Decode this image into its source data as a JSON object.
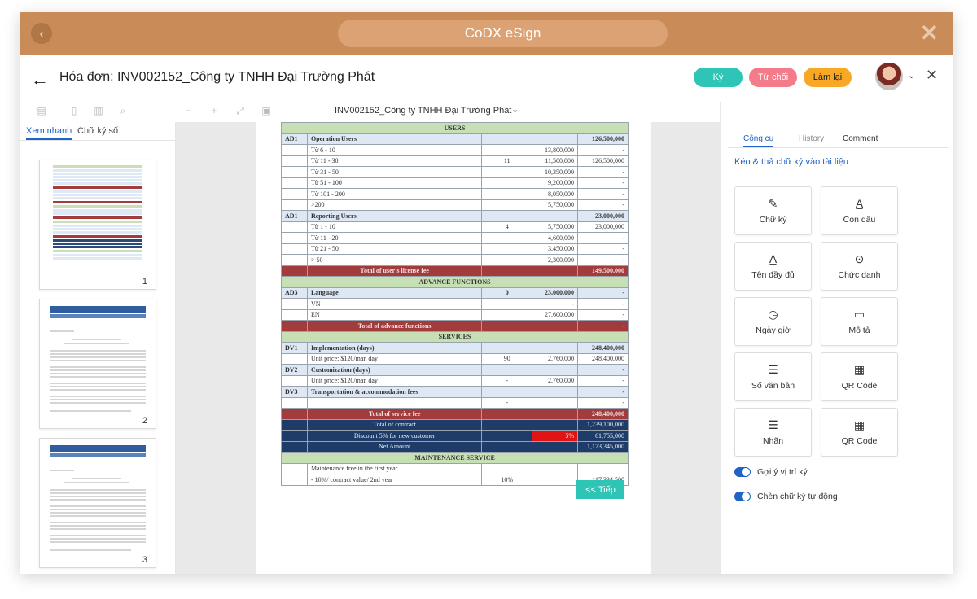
{
  "brand": {
    "title": "CoDX eSign"
  },
  "header": {
    "title": "Hóa đơn: INV002152_Công ty TNHH Đại Trường Phát",
    "btn_sign": "Ký",
    "btn_reject": "Từ chối",
    "btn_redo": "Làm lại"
  },
  "toolbar": {
    "doc_name": "INV002152_Công ty TNHH Đại Trường Phát"
  },
  "left_panel": {
    "tabs": [
      "Xem nhanh",
      "Chữ ký số"
    ],
    "pages": [
      "1",
      "2",
      "3"
    ]
  },
  "document": {
    "rows": [
      {
        "c": [
          "",
          "USERS",
          "",
          "",
          ""
        ],
        "s": "gr"
      },
      {
        "c": [
          "AD1",
          "Operation Users",
          "",
          "",
          "126,500,000"
        ],
        "s": "hl"
      },
      {
        "c": [
          "",
          "Từ 6 - 10",
          "",
          "13,800,000",
          "-"
        ],
        "s": ""
      },
      {
        "c": [
          "",
          "Từ 11 - 30",
          "11",
          "11,500,000",
          "126,500,000"
        ],
        "s": ""
      },
      {
        "c": [
          "",
          "Từ 31 - 50",
          "",
          "10,350,000",
          "-"
        ],
        "s": ""
      },
      {
        "c": [
          "",
          "Từ 51 - 100",
          "",
          "9,200,000",
          "-"
        ],
        "s": ""
      },
      {
        "c": [
          "",
          "Từ 101 - 200",
          "",
          "8,050,000",
          "-"
        ],
        "s": ""
      },
      {
        "c": [
          "",
          ">200",
          "",
          "5,750,000",
          "-"
        ],
        "s": ""
      },
      {
        "c": [
          "AD1",
          "Reporting Users",
          "",
          "",
          "23,000,000"
        ],
        "s": "hl"
      },
      {
        "c": [
          "",
          "Từ 1 - 10",
          "4",
          "5,750,000",
          "23,000,000"
        ],
        "s": ""
      },
      {
        "c": [
          "",
          "Từ 11 - 20",
          "",
          "4,600,000",
          "-"
        ],
        "s": ""
      },
      {
        "c": [
          "",
          "Từ 21 - 50",
          "",
          "3,450,000",
          "-"
        ],
        "s": ""
      },
      {
        "c": [
          "",
          "> 50",
          "",
          "2,300,000",
          "-"
        ],
        "s": ""
      },
      {
        "c": [
          "",
          "Total of user's license fee",
          "",
          "",
          "149,500,000"
        ],
        "s": "rd"
      },
      {
        "c": [
          "",
          "ADVANCE FUNCTIONS",
          "",
          "",
          ""
        ],
        "s": "gr"
      },
      {
        "c": [
          "AD3",
          "Language",
          "0",
          "23,000,000",
          "-"
        ],
        "s": "hl"
      },
      {
        "c": [
          "",
          "VN",
          "",
          "-",
          "-"
        ],
        "s": ""
      },
      {
        "c": [
          "",
          "EN",
          "",
          "27,600,000",
          "-"
        ],
        "s": ""
      },
      {
        "c": [
          "",
          "Total of advance functions",
          "",
          "",
          "-"
        ],
        "s": "rd"
      },
      {
        "c": [
          "",
          "SERVICES",
          "",
          "",
          ""
        ],
        "s": "gr"
      },
      {
        "c": [
          "DV1",
          "Implementation (days)",
          "",
          "",
          "248,400,000"
        ],
        "s": "hl"
      },
      {
        "c": [
          "",
          "Unit price: $120/man day",
          "90",
          "2,760,000",
          "248,400,000"
        ],
        "s": ""
      },
      {
        "c": [
          "DV2",
          "Customization (days)",
          "",
          "",
          "-"
        ],
        "s": "hl"
      },
      {
        "c": [
          "",
          "Unit price: $120/man day",
          "-",
          "2,760,000",
          "-"
        ],
        "s": ""
      },
      {
        "c": [
          "DV3",
          "Transportation & accommodation fees",
          "",
          "",
          "-"
        ],
        "s": "hl"
      },
      {
        "c": [
          "",
          "",
          "-",
          "",
          "-"
        ],
        "s": ""
      },
      {
        "c": [
          "",
          "Total of service fee",
          "",
          "",
          "248,400,000"
        ],
        "s": "rd"
      },
      {
        "c": [
          "",
          "Total of contract",
          "",
          "",
          "1,239,100,000"
        ],
        "s": "bl"
      },
      {
        "c": [
          "",
          "Discount 5% for new customer",
          "",
          "5%",
          "61,755,000"
        ],
        "s": "bl",
        "red": 3
      },
      {
        "c": [
          "",
          "Net Amount",
          "",
          "",
          "1,173,345,000"
        ],
        "s": "bl"
      },
      {
        "c": [
          "",
          "MAINTENANCE SERVICE",
          "",
          "",
          ""
        ],
        "s": "gr"
      },
      {
        "c": [
          "",
          "Maintenance free in the first year",
          "",
          "",
          ""
        ],
        "s": ""
      },
      {
        "c": [
          "",
          "- 10%/ contract value/ 2nd year",
          "10%",
          "",
          "117,334,500"
        ],
        "s": ""
      }
    ]
  },
  "next_button": "<< Tiếp",
  "right_panel": {
    "tabs": [
      "Công cụ",
      "History",
      "Comment"
    ],
    "heading": "Kéo & thả chữ ký vào tài liệu",
    "tools": [
      {
        "label": "Chữ ký",
        "icon": "✎",
        "name": "signature"
      },
      {
        "label": "Con dấu",
        "icon": "A̲",
        "name": "stamp"
      },
      {
        "label": "Tên đầy đủ",
        "icon": "A̲",
        "name": "full-name"
      },
      {
        "label": "Chức danh",
        "icon": "⊙",
        "name": "position"
      },
      {
        "label": "Ngày giờ",
        "icon": "◷",
        "name": "datetime"
      },
      {
        "label": "Mô tả",
        "icon": "▭",
        "name": "description"
      },
      {
        "label": "Số văn bản",
        "icon": "☰",
        "name": "doc-number"
      },
      {
        "label": "QR Code",
        "icon": "▦",
        "name": "qr-code"
      },
      {
        "label": "Nhãn",
        "icon": "☰",
        "name": "label"
      },
      {
        "label": "QR Code",
        "icon": "▦",
        "name": "qr-code-2"
      }
    ],
    "toggles": [
      {
        "label": "Gợi ý vị trí ký",
        "on": true
      },
      {
        "label": "Chèn chữ ký tự động",
        "on": true
      }
    ]
  },
  "colors": {
    "brand": "#c98b57",
    "accent_teal": "#2ec4b6",
    "accent_pink": "#f47c8a",
    "accent_orange": "#f9a825",
    "link_blue": "#1f63c6"
  }
}
